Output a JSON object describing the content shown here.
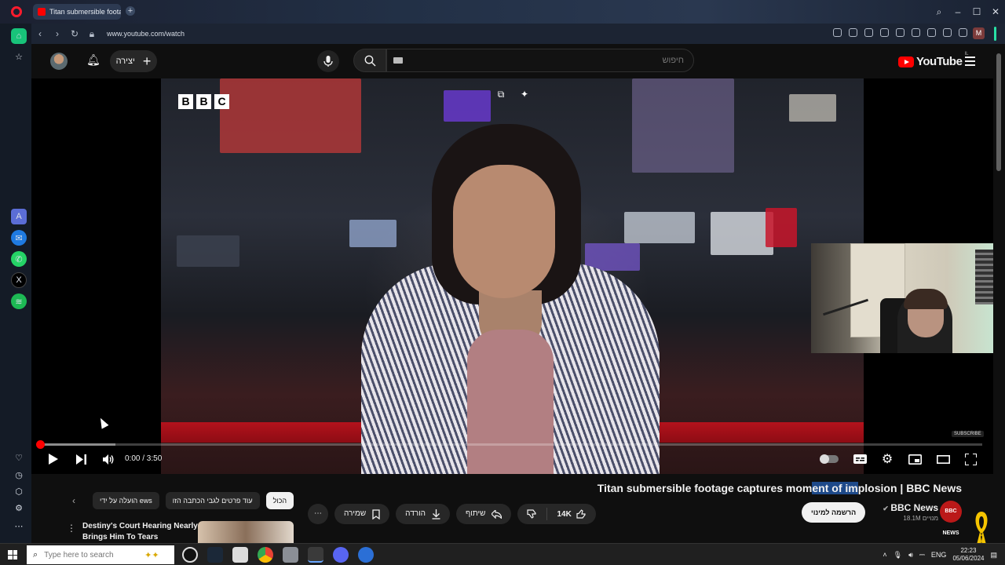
{
  "browser": {
    "tab_title": "Titan submersible footage",
    "url": "www.youtube.com/watch",
    "profile_initial": "M"
  },
  "youtube_header": {
    "create_label": "יצירה",
    "search_placeholder": "חיפוש",
    "logo_text": "YouTube",
    "region": "IL"
  },
  "player": {
    "watermark": [
      "B",
      "B",
      "C"
    ],
    "end_tag": "SUBSCRIBE",
    "time": "0:00 / 3:50",
    "progress_played": 0.0,
    "progress_buffered": 0.08
  },
  "video": {
    "title_before": "Titan submersible footage captures mom",
    "title_highlight": "ent of im",
    "title_after": "plosion | BBC News",
    "channel_name": "BBC News",
    "channel_subs": "18.1M מנויים",
    "channel_avatar_text": "BBC NEWS",
    "subscribe_label": "הרשמה למינוי",
    "like_count": "14K",
    "share_label": "שיתוף",
    "download_label": "הורדה",
    "save_label": "שמירה"
  },
  "chips": [
    {
      "label": "הכול",
      "active": true
    },
    {
      "label": "עוד פרטים לגבי הכתבה הזו",
      "active": false
    },
    {
      "label": "הועלה על ידי ews",
      "active": false
    }
  ],
  "recommendation": {
    "title": "Destiny's Court Hearing Nearly Brings Him To Tears"
  },
  "taskbar": {
    "search_placeholder": "Type here to search",
    "lang": "ENG",
    "time": "22:23",
    "date": "05/06/2024"
  },
  "colors": {
    "yt_red": "#ff0000",
    "bbc_red": "#bb1919",
    "opera_red": "#ff1b2d",
    "accent_green": "#28e0a5"
  }
}
